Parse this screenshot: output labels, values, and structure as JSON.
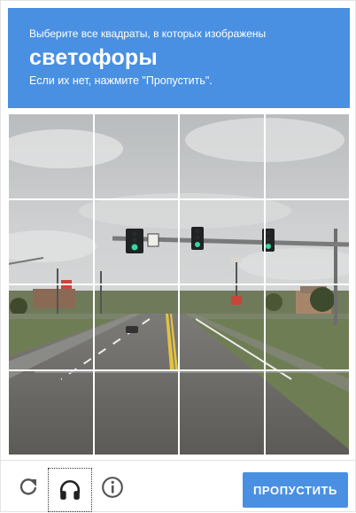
{
  "challenge": {
    "instruction_line1": "Выберите все квадраты, в которых изображены",
    "target_object": "светофоры",
    "instruction_line3": "Если их нет, нажмите \"Пропустить\"."
  },
  "grid": {
    "rows": 4,
    "cols": 4,
    "image_description": "street-intersection-traffic-lights"
  },
  "footer": {
    "reload_icon": "reload-icon",
    "audio_icon": "headphones-icon",
    "info_icon": "info-icon",
    "skip_label": "ПРОПУСТИТЬ"
  },
  "colors": {
    "accent": "#4a90e2",
    "header_text": "#ffffff"
  }
}
